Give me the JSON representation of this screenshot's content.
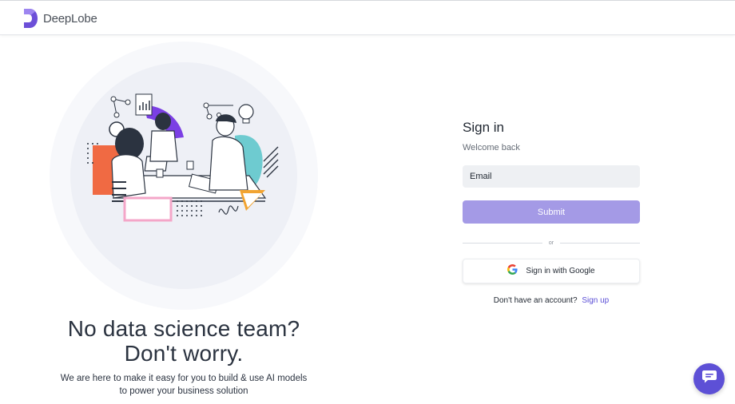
{
  "brand": {
    "name": "DeepLobe",
    "logo_color": "#6c4fd8"
  },
  "hero": {
    "headline_line1": "No data science team?",
    "headline_line2": "Don't worry.",
    "description_line1": "We are here to make it easy for you to build & use AI models",
    "description_line2": "to power your business solution"
  },
  "signin": {
    "title": "Sign in",
    "subtitle": "Welcome back",
    "email_placeholder": "Email",
    "submit_label": "Submit",
    "divider_text": "or",
    "google_label": "Sign in with Google",
    "no_account_text": "Don't have an account?",
    "signup_label": "Sign up"
  },
  "colors": {
    "accent": "#5d50d6",
    "submit_bg": "#a49ae6",
    "input_bg": "#eef0f3"
  },
  "icons": {
    "logo": "deeplobe-logo-icon",
    "google": "google-g-icon",
    "chat": "chat-bubble-icon"
  }
}
